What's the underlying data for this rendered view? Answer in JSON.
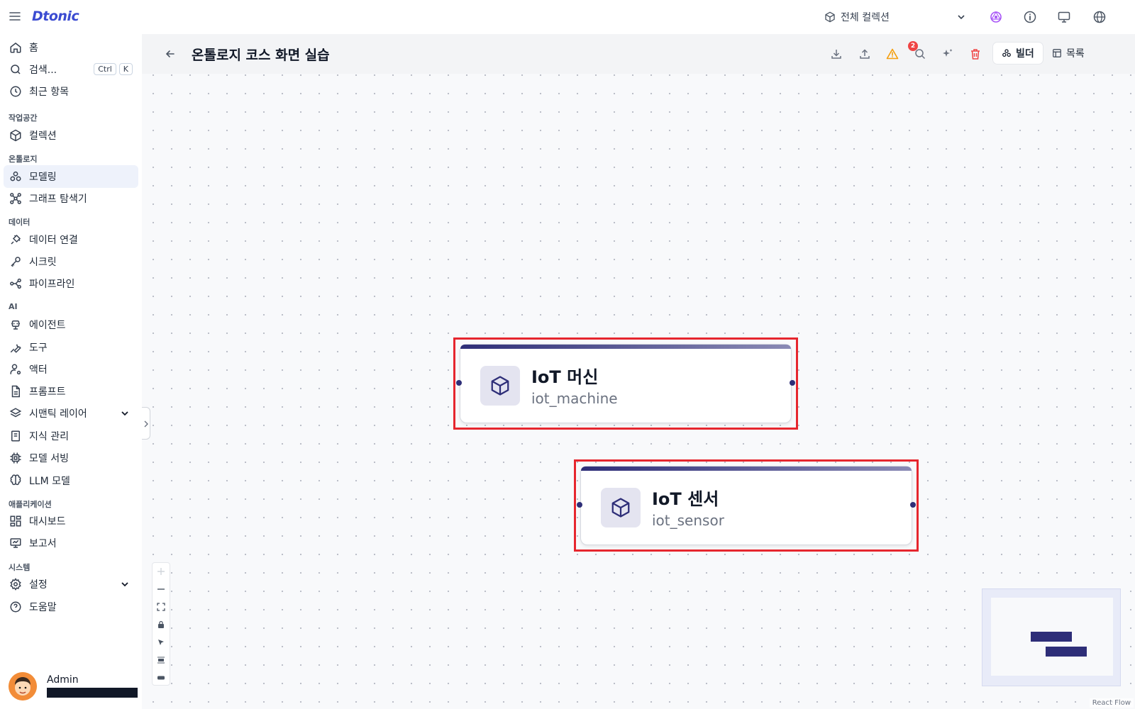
{
  "app": {
    "logo": "Dtonic"
  },
  "topbar": {
    "collection_select": "전체 컬렉션"
  },
  "sidebar": {
    "home": "홈",
    "search": "검색...",
    "search_kbd": [
      "Ctrl",
      "K"
    ],
    "recent": "최근 항목",
    "section_workspace": "작업공간",
    "collection": "컬렉션",
    "section_ontology": "온톨로지",
    "modeling": "모델링",
    "graph_explorer": "그래프 탐색기",
    "section_data": "데이터",
    "data_connection": "데이터 연결",
    "secret": "시크릿",
    "pipeline": "파이프라인",
    "section_ai": "AI",
    "agent": "에이전트",
    "tool": "도구",
    "actor": "액터",
    "prompt": "프롬프트",
    "semantic_layer": "시맨틱 레이어",
    "knowledge": "지식 관리",
    "model_serving": "모델 서빙",
    "llm_model": "LLM 모델",
    "section_app": "애플리케이션",
    "dashboard": "대시보드",
    "report": "보고서",
    "section_system": "시스템",
    "settings": "설정",
    "help": "도움말"
  },
  "user": {
    "name": "Admin"
  },
  "header": {
    "title": "온톨로지 코스 화면 실습",
    "warning_count": "2",
    "builder_label": "빌더",
    "list_label": "목록"
  },
  "nodes": [
    {
      "title": "IoT 머신",
      "api_name": "iot_machine",
      "highlighted": true
    },
    {
      "title": "IoT 센서",
      "api_name": "iot_sensor",
      "highlighted": true
    }
  ],
  "canvas": {
    "attribution": "React Flow"
  },
  "colors": {
    "accent": "#2e2e78",
    "highlight": "#e6262e",
    "brand": "#3b4bd1",
    "warning": "#f59e0b",
    "danger": "#ef4444"
  }
}
